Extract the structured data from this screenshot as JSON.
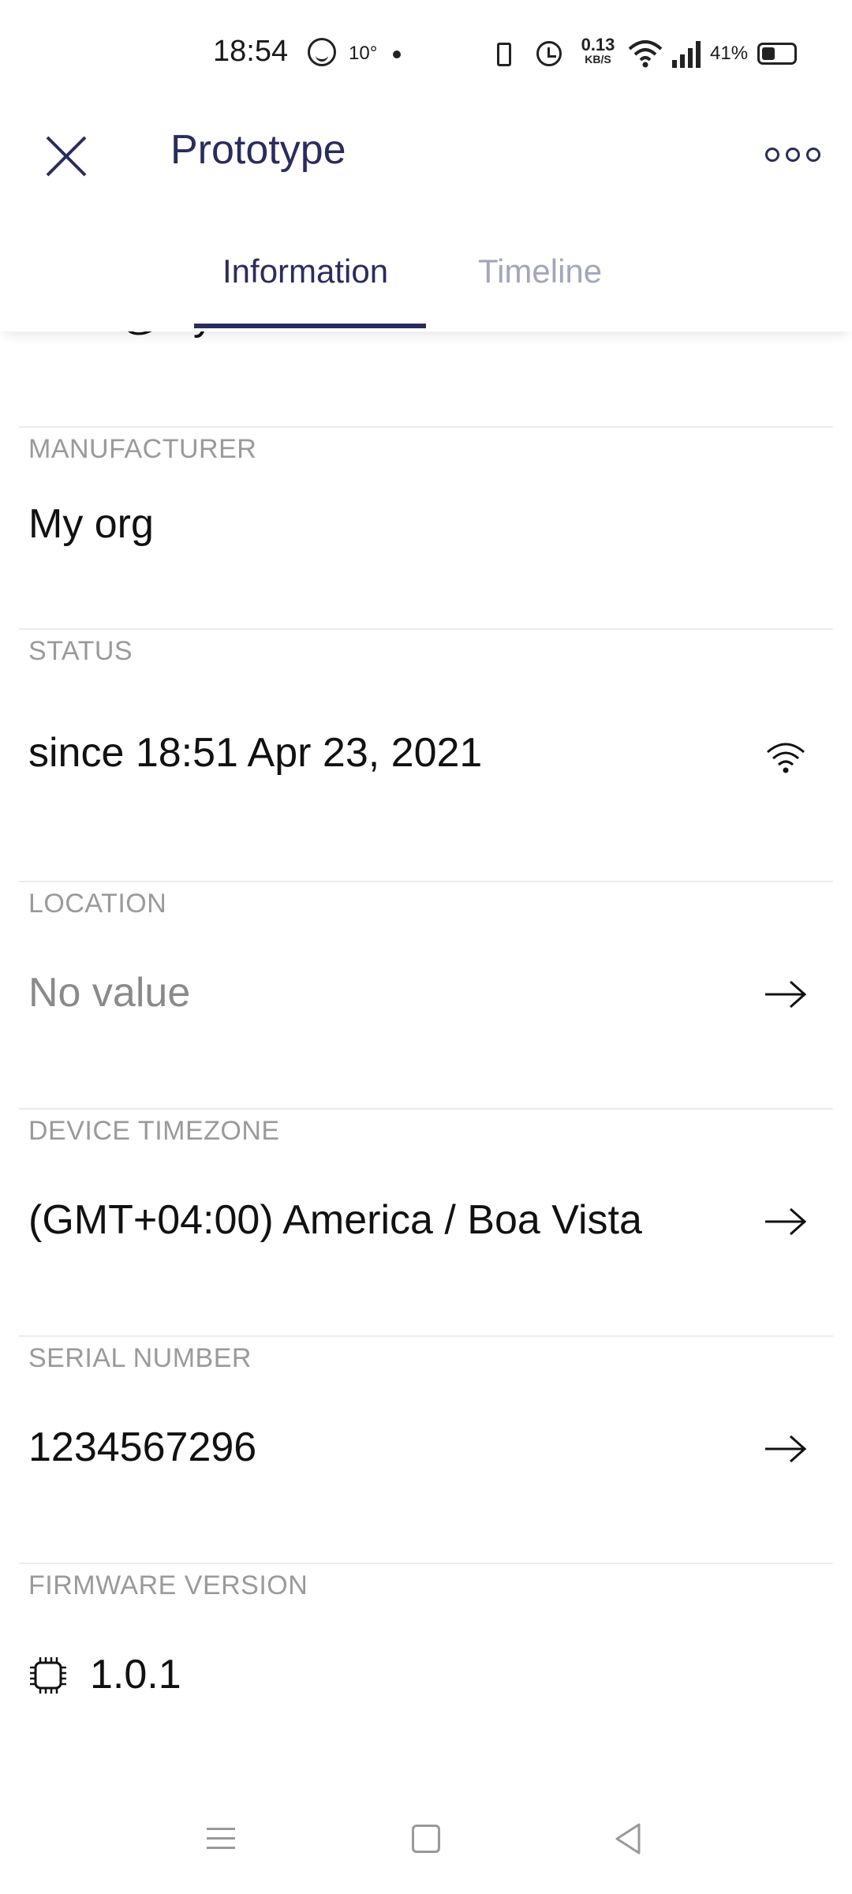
{
  "status_bar": {
    "time": "18:54",
    "temperature": "10°",
    "network_speed_value": "0.13",
    "network_speed_unit": "KB/S",
    "battery_percent": "41%",
    "battery_level": 0.41
  },
  "header": {
    "title": "Prototype",
    "tabs": [
      {
        "label": "Information",
        "active": true
      },
      {
        "label": "Timeline",
        "active": false
      }
    ]
  },
  "fields": {
    "owner_partial": "mark@blynk.cc",
    "manufacturer": {
      "label": "MANUFACTURER",
      "value": "My org"
    },
    "status": {
      "label": "STATUS",
      "value": "since 18:51 Apr 23, 2021",
      "icon": "wifi-icon"
    },
    "location": {
      "label": "LOCATION",
      "value": "No value",
      "icon": "arrow-right-icon"
    },
    "timezone": {
      "label": "DEVICE TIMEZONE",
      "value": "(GMT+04:00) America / Boa Vista",
      "icon": "arrow-right-icon"
    },
    "serial": {
      "label": "SERIAL NUMBER",
      "value": "1234567296",
      "icon": "arrow-right-icon"
    },
    "firmware": {
      "label": "FIRMWARE VERSION",
      "value": "1.0.1",
      "icon": "chip-icon"
    }
  },
  "colors": {
    "accent": "#2a2c5e",
    "tab_inactive": "#a3a6bc",
    "label": "#9a9a9a",
    "divider": "#ececec"
  }
}
